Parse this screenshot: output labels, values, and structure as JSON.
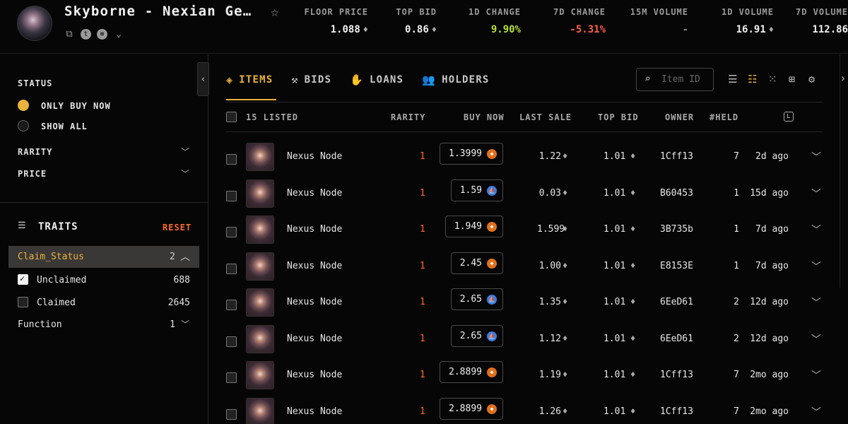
{
  "header": {
    "title": "Skyborne - Nexian Ge…",
    "stats": [
      {
        "label": "FLOOR PRICE",
        "value": "1.088",
        "currency": "eth"
      },
      {
        "label": "TOP BID",
        "value": "0.86",
        "currency": "eth"
      },
      {
        "label": "1D CHANGE",
        "value": "9.90%",
        "trend": "up"
      },
      {
        "label": "7D CHANGE",
        "value": "-5.31%",
        "trend": "down"
      },
      {
        "label": "15M VOLUME",
        "value": "-"
      },
      {
        "label": "1D VOLUME",
        "value": "16.91",
        "currency": "eth"
      },
      {
        "label": "7D VOLUME",
        "value": "112.86"
      }
    ],
    "link_icons": [
      "copy-icon",
      "twitter-icon",
      "globe-icon",
      "chevron-down-icon"
    ]
  },
  "sidebar": {
    "status_label": "STATUS",
    "status_options": [
      {
        "label": "ONLY BUY NOW",
        "selected": true
      },
      {
        "label": "SHOW ALL",
        "selected": false
      }
    ],
    "filters": [
      {
        "label": "RARITY"
      },
      {
        "label": "PRICE"
      }
    ],
    "traits_label": "TRAITS",
    "reset_label": "RESET",
    "trait_groups": [
      {
        "name": "Claim_Status",
        "count": "2",
        "expanded": true,
        "options": [
          {
            "label": "Unclaimed",
            "count": "688",
            "checked": true
          },
          {
            "label": "Claimed",
            "count": "2645",
            "checked": false
          }
        ]
      },
      {
        "name": "Function",
        "count": "1",
        "expanded": false
      }
    ]
  },
  "tabs": [
    {
      "label": "ITEMS",
      "icon": "layers-icon",
      "active": true
    },
    {
      "label": "BIDS",
      "icon": "gavel-icon",
      "active": false
    },
    {
      "label": "LOANS",
      "icon": "hand-coin-icon",
      "active": false
    },
    {
      "label": "HOLDERS",
      "icon": "users-icon",
      "active": false
    }
  ],
  "search": {
    "placeholder": "Item ID"
  },
  "view_icons": [
    "list-view-icon",
    "detailed-list-view-icon",
    "small-grid-view-icon",
    "large-grid-view-icon",
    "settings-icon"
  ],
  "table": {
    "listed_label": "15 LISTED",
    "columns": [
      "RARITY",
      "BUY NOW",
      "LAST SALE",
      "TOP BID",
      "OWNER",
      "#HELD"
    ],
    "rows": [
      {
        "name": "Nexus Node",
        "rarity": "1",
        "buy_now": "1.3999",
        "marketplace": "orange",
        "last_sale": "1.22",
        "top_bid": "1.01",
        "owner": "1Cff13",
        "held": "7",
        "time": "2d ago"
      },
      {
        "name": "Nexus Node",
        "rarity": "1",
        "buy_now": "1.59",
        "marketplace": "blue",
        "last_sale": "0.03",
        "top_bid": "1.01",
        "owner": "B60453",
        "held": "1",
        "time": "15d ago"
      },
      {
        "name": "Nexus Node",
        "rarity": "1",
        "buy_now": "1.949",
        "marketplace": "orange",
        "last_sale": "1.599",
        "top_bid": "1.01",
        "owner": "3B735b",
        "held": "1",
        "time": "7d ago"
      },
      {
        "name": "Nexus Node",
        "rarity": "1",
        "buy_now": "2.45",
        "marketplace": "orange",
        "last_sale": "1.00",
        "top_bid": "1.01",
        "owner": "E8153E",
        "held": "1",
        "time": "7d ago"
      },
      {
        "name": "Nexus Node",
        "rarity": "1",
        "buy_now": "2.65",
        "marketplace": "blue",
        "last_sale": "1.35",
        "top_bid": "1.01",
        "owner": "6EeD61",
        "held": "2",
        "time": "12d ago"
      },
      {
        "name": "Nexus Node",
        "rarity": "1",
        "buy_now": "2.65",
        "marketplace": "blue",
        "last_sale": "1.12",
        "top_bid": "1.01",
        "owner": "6EeD61",
        "held": "2",
        "time": "12d ago"
      },
      {
        "name": "Nexus Node",
        "rarity": "1",
        "buy_now": "2.8899",
        "marketplace": "orange",
        "last_sale": "1.19",
        "top_bid": "1.01",
        "owner": "1Cff13",
        "held": "7",
        "time": "2mo ago"
      },
      {
        "name": "Nexus Node",
        "rarity": "1",
        "buy_now": "2.8899",
        "marketplace": "orange",
        "last_sale": "1.26",
        "top_bid": "1.01",
        "owner": "1Cff13",
        "held": "7",
        "time": "2mo ago"
      }
    ]
  },
  "colors": {
    "accent": "#e9b13d",
    "positive": "#b5e03d",
    "negative": "#ff5f4a",
    "rarity": "#ff6a2b"
  }
}
